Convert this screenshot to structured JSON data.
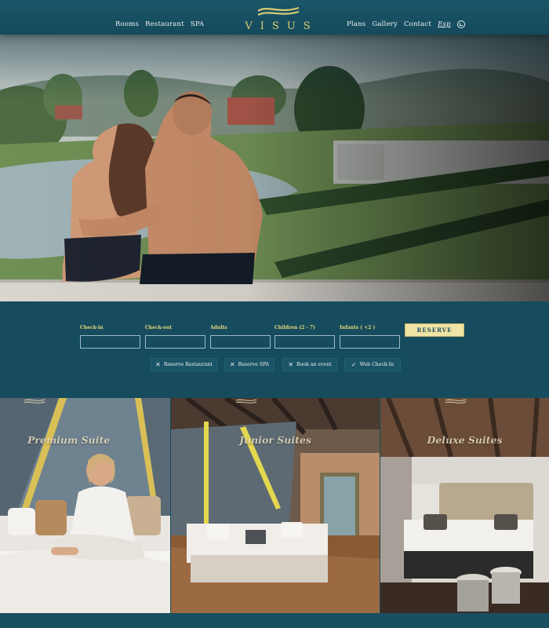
{
  "nav": {
    "left_links": [
      "Rooms",
      "Restaurant",
      "SPA"
    ],
    "right_links": [
      "Plans",
      "Gallery",
      "Contact"
    ],
    "lang": "Esp",
    "logo_text": "VISUS",
    "whatsapp_icon": "whatsapp-icon"
  },
  "booking": {
    "fields": [
      {
        "label": "Check-in",
        "value": ""
      },
      {
        "label": "Check-out",
        "value": ""
      },
      {
        "label": "Adults",
        "value": ""
      },
      {
        "label": "Children (2 - 7)",
        "value": ""
      },
      {
        "label": "Infants ( <2 )",
        "value": ""
      }
    ],
    "reserve_label": "RESERVE",
    "quick_links": [
      "Reserve Restaurant",
      "Reserve SPA",
      "Book an event",
      "Web Check-In"
    ]
  },
  "suites": [
    {
      "title": "Premium Suite"
    },
    {
      "title": "Junior Suites"
    },
    {
      "title": "Deluxe Suites"
    }
  ],
  "colors": {
    "brand": "#164c5e",
    "accent": "#e8d87a",
    "button": "#efe3a5"
  }
}
